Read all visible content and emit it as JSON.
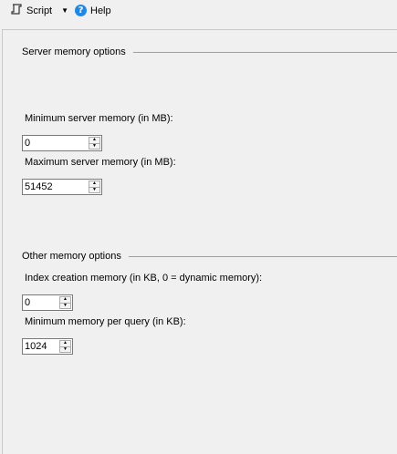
{
  "toolbar": {
    "script_label": "Script",
    "help_label": "Help",
    "script_icon": "script-icon",
    "dropdown_icon": "chevron-down-icon",
    "help_icon": "help-icon"
  },
  "server_memory": {
    "section_title": "Server memory options",
    "min_label": "Minimum server memory (in MB):",
    "min_value": "0",
    "max_label": "Maximum server memory (in MB):",
    "max_value": "51452"
  },
  "other_memory": {
    "section_title": "Other memory options",
    "index_label": "Index creation memory (in KB, 0 = dynamic memory):",
    "index_value": "0",
    "min_query_label": "Minimum memory per query (in KB):",
    "min_query_value": "1024"
  },
  "colors": {
    "help_icon": "#1e88e5",
    "background": "#f0f0f0"
  }
}
